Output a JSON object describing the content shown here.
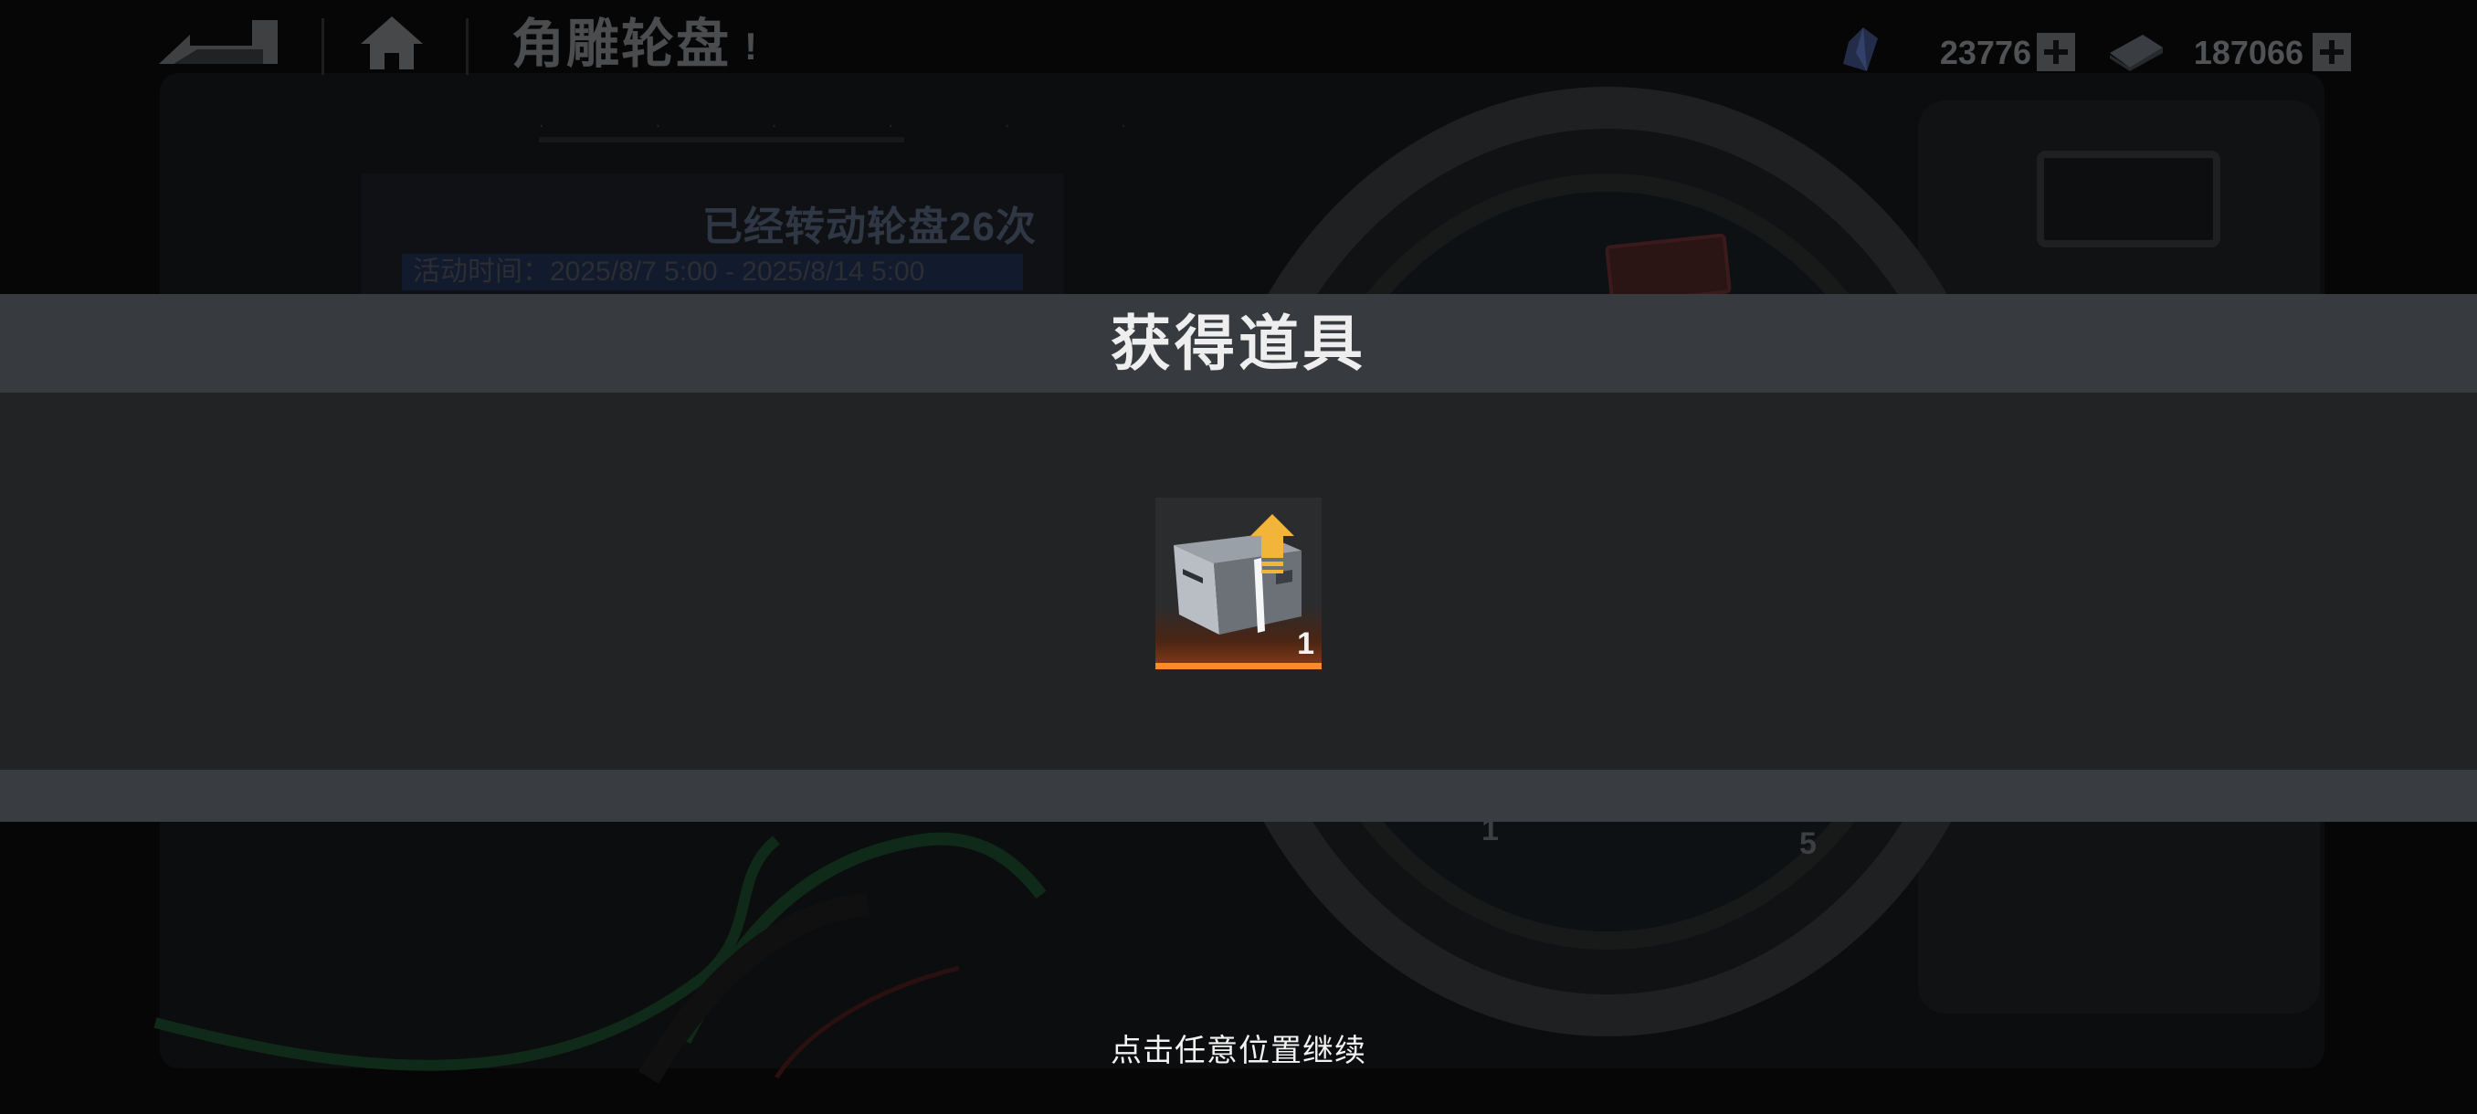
{
  "topbar": {
    "title": "角雕轮盘",
    "info_symbol": "!",
    "currency_1": {
      "icon": "blue-crystal-icon",
      "value": "23776"
    },
    "currency_2": {
      "icon": "cash-bundle-icon",
      "value": "187066"
    }
  },
  "background": {
    "spin_count_text": "已经转动轮盘26次",
    "event_time_text": "活动时间：2025/8/7 5:00 - 2025/8/14 5:00",
    "wheel_numbers": [
      "1",
      "5"
    ]
  },
  "modal": {
    "title": "获得道具",
    "item": {
      "icon": "upgrade-supply-box-icon",
      "count": "1"
    },
    "continue_hint": "点击任意位置继续"
  },
  "colors": {
    "modal_header": "#373a3e",
    "modal_body": "#222325",
    "item_glow": "#ff8a2a",
    "upgrade_arrow": "#f2b53a"
  }
}
